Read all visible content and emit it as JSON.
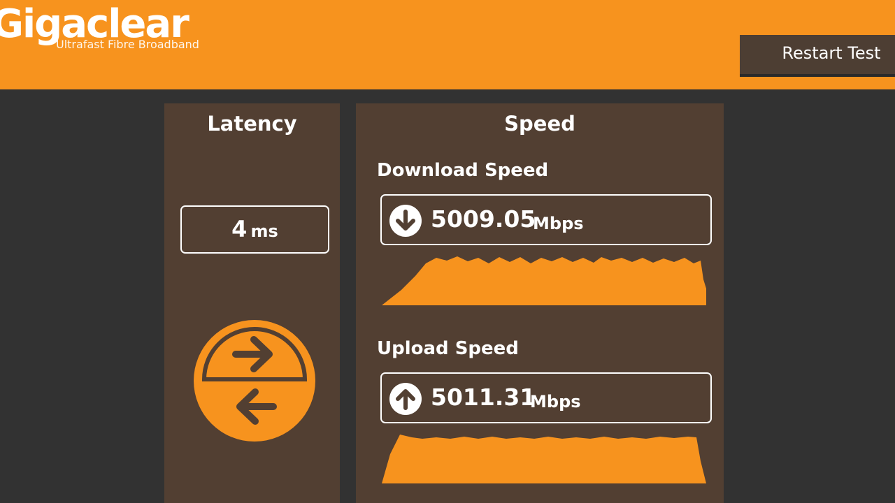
{
  "header": {
    "logo": "Gigaclear",
    "tagline": "Ultrafast Fibre Broadband",
    "restart_label": "Restart Test"
  },
  "latency": {
    "title": "Latency",
    "value": "4",
    "unit": "ms"
  },
  "speed": {
    "title": "Speed",
    "download": {
      "label": "Download Speed",
      "value": "5009.05",
      "unit": "Mbps"
    },
    "upload": {
      "label": "Upload Speed",
      "value": "5011.31",
      "unit": "Mbps"
    }
  },
  "colors": {
    "accent": "#f7931e",
    "panel": "#523f32",
    "background": "#323232"
  },
  "icons": [
    "download-arrow-icon",
    "upload-arrow-icon",
    "latency-arrows-icon"
  ]
}
